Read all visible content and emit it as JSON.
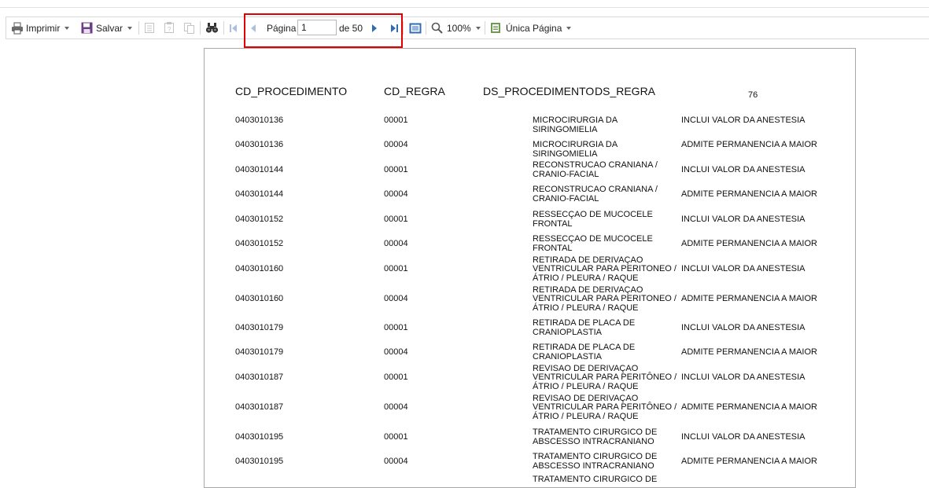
{
  "toolbar": {
    "print_label": "Imprimir",
    "save_label": "Salvar",
    "page_label": "Página",
    "page_value": "1",
    "page_total": "de 50",
    "zoom_label": "100%",
    "view_label": "Única Página"
  },
  "report": {
    "headers": [
      "CD_PROCEDIMENTO",
      "CD_REGRA",
      "DS_PROCEDIMENTO",
      "DS_REGRA"
    ],
    "page_marker": "76",
    "rows": [
      {
        "cd": "0403010136",
        "regra": "00001",
        "ds_lines": [
          "MICROCIRURGIA DA SIRINGOMIELIA"
        ],
        "ds_regra": "INCLUI VALOR DA ANESTESIA"
      },
      {
        "cd": "0403010136",
        "regra": "00004",
        "ds_lines": [
          "MICROCIRURGIA DA SIRINGOMIELIA"
        ],
        "ds_regra": "ADMITE PERMANENCIA A MAIOR"
      },
      {
        "cd": "0403010144",
        "regra": "00001",
        "ds_lines": [
          "RECONSTRUCAO CRANIANA /",
          "CRANIO-FACIAL"
        ],
        "ds_regra": "INCLUI VALOR DA ANESTESIA"
      },
      {
        "cd": "0403010144",
        "regra": "00004",
        "ds_lines": [
          "RECONSTRUCAO CRANIANA /",
          "CRANIO-FACIAL"
        ],
        "ds_regra": "ADMITE PERMANENCIA A MAIOR"
      },
      {
        "cd": "0403010152",
        "regra": "00001",
        "ds_lines": [
          "RESSECÇAO DE MUCOCELE",
          "FRONTAL"
        ],
        "ds_regra": "INCLUI VALOR DA ANESTESIA"
      },
      {
        "cd": "0403010152",
        "regra": "00004",
        "ds_lines": [
          "RESSECÇAO DE MUCOCELE",
          "FRONTAL"
        ],
        "ds_regra": "ADMITE PERMANENCIA A MAIOR"
      },
      {
        "cd": "0403010160",
        "regra": "00001",
        "ds_lines": [
          "RETIRADA DE DERIVAÇAO",
          "VENTRICULAR PARA PERITONEO /",
          "ÁTRIO / PLEURA / RAQUE"
        ],
        "ds_regra": "INCLUI VALOR DA ANESTESIA"
      },
      {
        "cd": "0403010160",
        "regra": "00004",
        "ds_lines": [
          "RETIRADA DE DERIVAÇAO",
          "VENTRICULAR PARA PERITONEO /",
          "ÁTRIO / PLEURA / RAQUE"
        ],
        "ds_regra": "ADMITE PERMANENCIA A MAIOR"
      },
      {
        "cd": "0403010179",
        "regra": "00001",
        "ds_lines": [
          "RETIRADA DE PLACA DE",
          "CRANIOPLASTIA"
        ],
        "ds_regra": "INCLUI VALOR DA ANESTESIA"
      },
      {
        "cd": "0403010179",
        "regra": "00004",
        "ds_lines": [
          "RETIRADA DE PLACA DE",
          "CRANIOPLASTIA"
        ],
        "ds_regra": "ADMITE PERMANENCIA A MAIOR"
      },
      {
        "cd": "0403010187",
        "regra": "00001",
        "ds_lines": [
          "REVISAO DE DERIVAÇAO",
          "VENTRICULAR PARA PERITÔNEO /",
          "ÁTRIO / PLEURA / RAQUE"
        ],
        "ds_regra": "INCLUI VALOR DA ANESTESIA"
      },
      {
        "cd": "0403010187",
        "regra": "00004",
        "ds_lines": [
          "REVISAO DE DERIVAÇAO",
          "VENTRICULAR PARA PERITÔNEO /",
          "ÁTRIO / PLEURA / RAQUE"
        ],
        "ds_regra": "ADMITE PERMANENCIA A MAIOR"
      },
      {
        "cd": "0403010195",
        "regra": "00001",
        "ds_lines": [
          "TRATAMENTO CIRURGICO DE",
          "ABSCESSO INTRACRANIANO"
        ],
        "ds_regra": "INCLUI VALOR DA ANESTESIA"
      },
      {
        "cd": "0403010195",
        "regra": "00004",
        "ds_lines": [
          "TRATAMENTO CIRURGICO DE",
          "ABSCESSO INTRACRANIANO"
        ],
        "ds_regra": "ADMITE PERMANENCIA A MAIOR"
      },
      {
        "cd": "",
        "regra": "",
        "ds_lines": [
          "TRATAMENTO CIRURGICO DE"
        ],
        "ds_regra": ""
      }
    ]
  },
  "colors": {
    "highlight": "#e00000",
    "nav_blue": "#2f6cb5",
    "icon_disabled": "#c4c4c4"
  }
}
